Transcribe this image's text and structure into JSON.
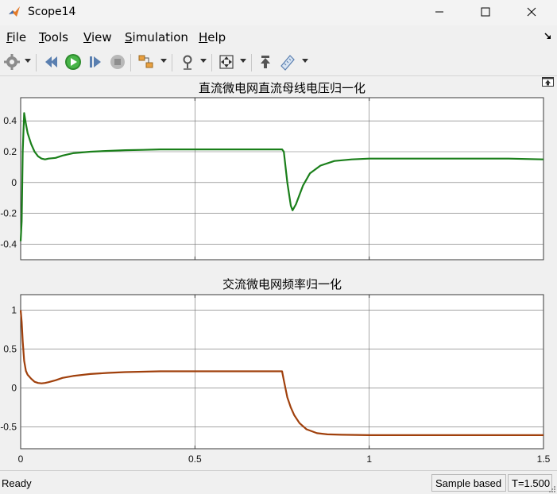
{
  "window": {
    "title": "Scope14"
  },
  "menu": {
    "items": [
      {
        "label": "File",
        "mnemonic": "F",
        "rest": "ile"
      },
      {
        "label": "Tools",
        "mnemonic": "T",
        "rest": "ools"
      },
      {
        "label": "View",
        "mnemonic": "V",
        "rest": "iew"
      },
      {
        "label": "Simulation",
        "mnemonic": "S",
        "rest": "imulation"
      },
      {
        "label": "Help",
        "mnemonic": "H",
        "rest": "elp"
      }
    ]
  },
  "toolbar": {
    "icons": [
      "settings-icon",
      "step-back-icon",
      "run-icon",
      "step-forward-icon",
      "stop-icon",
      "highlight-block-icon",
      "zoom-icon",
      "autoscale-icon",
      "restore-layout-icon",
      "measurements-icon"
    ]
  },
  "status": {
    "ready": "Ready",
    "mode": "Sample based",
    "time": "T=1.500"
  },
  "colors": {
    "plot1_line": "#1a7f1a",
    "plot2_line": "#a0400c",
    "grid": "#6e6e6e",
    "axes_bg": "#ffffff"
  },
  "chart_data": [
    {
      "type": "line",
      "title": "直流微电网直流母线电压归一化",
      "xlim": [
        0,
        1.5
      ],
      "ylim": [
        -0.5,
        0.55
      ],
      "yticks": [
        "0.4",
        "0.2",
        "0",
        "-0.2",
        "-0.4"
      ],
      "ytick_values": [
        0.4,
        0.2,
        0,
        -0.2,
        -0.4
      ],
      "xticks": [
        0,
        0.5,
        1,
        1.5
      ],
      "grid": true,
      "series": [
        {
          "x": [
            0,
            0.003,
            0.006,
            0.01,
            0.015,
            0.02,
            0.03,
            0.04,
            0.05,
            0.06,
            0.07,
            0.08,
            0.1,
            0.12,
            0.15,
            0.2,
            0.25,
            0.3,
            0.35,
            0.4,
            0.5,
            0.6,
            0.7,
            0.75,
            0.755,
            0.765,
            0.775,
            0.78,
            0.79,
            0.8,
            0.81,
            0.83,
            0.86,
            0.9,
            0.95,
            1.0,
            1.1,
            1.2,
            1.3,
            1.4,
            1.5
          ],
          "y": [
            -0.38,
            -0.25,
            0.2,
            0.45,
            0.38,
            0.32,
            0.25,
            0.2,
            0.17,
            0.155,
            0.15,
            0.155,
            0.16,
            0.175,
            0.19,
            0.2,
            0.205,
            0.21,
            0.212,
            0.215,
            0.215,
            0.215,
            0.215,
            0.215,
            0.2,
            0.0,
            -0.15,
            -0.18,
            -0.14,
            -0.08,
            -0.02,
            0.06,
            0.11,
            0.14,
            0.15,
            0.155,
            0.155,
            0.155,
            0.155,
            0.155,
            0.15
          ]
        }
      ]
    },
    {
      "type": "line",
      "title": "交流微电网频率归一化",
      "xlim": [
        0,
        1.5
      ],
      "ylim": [
        -0.78,
        1.2
      ],
      "yticks": [
        "1",
        "0.5",
        "0",
        "-0.5"
      ],
      "ytick_values": [
        1,
        0.5,
        0,
        -0.5
      ],
      "xticks": [
        "0",
        "0.5",
        "1",
        "1.5"
      ],
      "xtick_values": [
        0,
        0.5,
        1,
        1.5
      ],
      "grid": true,
      "series": [
        {
          "x": [
            0,
            0.003,
            0.006,
            0.01,
            0.015,
            0.02,
            0.03,
            0.04,
            0.05,
            0.06,
            0.07,
            0.08,
            0.1,
            0.12,
            0.15,
            0.2,
            0.25,
            0.3,
            0.35,
            0.4,
            0.5,
            0.6,
            0.7,
            0.75,
            0.755,
            0.765,
            0.775,
            0.785,
            0.8,
            0.82,
            0.85,
            0.88,
            0.92,
            1.0,
            1.1,
            1.2,
            1.3,
            1.4,
            1.5
          ],
          "y": [
            1.0,
            0.85,
            0.6,
            0.35,
            0.22,
            0.17,
            0.12,
            0.08,
            0.065,
            0.06,
            0.065,
            0.075,
            0.1,
            0.13,
            0.155,
            0.18,
            0.195,
            0.205,
            0.21,
            0.215,
            0.215,
            0.215,
            0.215,
            0.215,
            0.1,
            -0.12,
            -0.25,
            -0.35,
            -0.45,
            -0.53,
            -0.58,
            -0.595,
            -0.6,
            -0.605,
            -0.605,
            -0.605,
            -0.605,
            -0.605,
            -0.605
          ]
        }
      ]
    }
  ]
}
